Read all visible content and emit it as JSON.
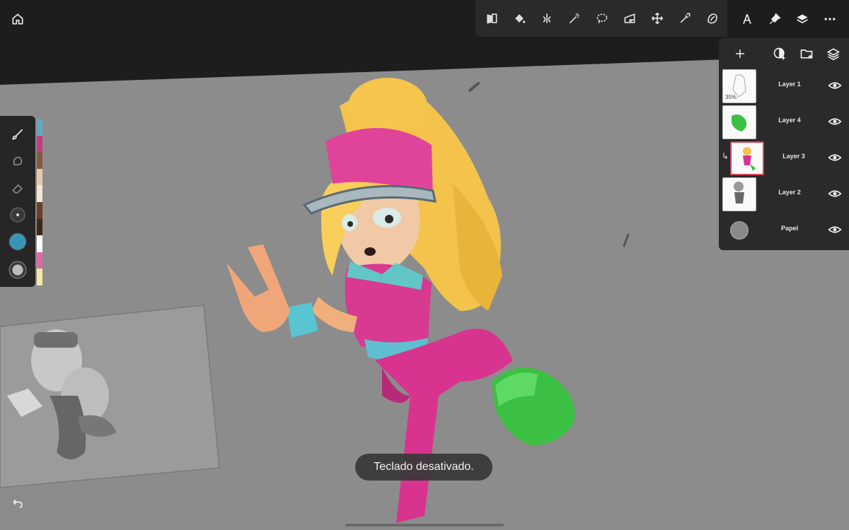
{
  "toolbar": {
    "icons": [
      "image-adjust-icon",
      "fill-icon",
      "symmetry-icon",
      "magic-wand-icon",
      "lasso-icon",
      "perspective-icon",
      "move-icon",
      "eyedropper-icon",
      "liquify-icon"
    ]
  },
  "right_tools": {
    "icons": [
      "ruler-compass-icon",
      "pin-icon",
      "layers-icon",
      "more-icon"
    ]
  },
  "left_palette": {
    "tools": [
      "brush-icon",
      "smudge-icon",
      "eraser-icon",
      "brush-size-icon",
      "current-color-swatch",
      "brush-opacity-icon"
    ],
    "current_color": "#3a95b5",
    "strip_colors": [
      "#5fa9c4",
      "#c83a7f",
      "#8a5a3c",
      "#e5cba8",
      "#f2e6d4",
      "#6e3d24",
      "#3a2818",
      "#ffffff",
      "#e565a4",
      "#f4eaa2"
    ]
  },
  "layers_panel": {
    "add_icon": "plus-icon",
    "new_fill_layer_icon": "new-fill-layer-icon",
    "new_group_icon": "new-folder-icon",
    "blend_icon": "stacked-layers-icon",
    "layers": [
      {
        "name": "Layer 1",
        "opacity": "35%",
        "selected": false,
        "clipped": false
      },
      {
        "name": "Layer 4",
        "opacity": "",
        "selected": false,
        "clipped": false
      },
      {
        "name": "Layer 3",
        "opacity": "",
        "selected": true,
        "clipped": true
      },
      {
        "name": "Layer 2",
        "opacity": "",
        "selected": false,
        "clipped": false
      }
    ],
    "paper": {
      "name": "Papel",
      "color": "#8a8a8a"
    }
  },
  "toast": {
    "text": "Teclado desativado."
  },
  "colors": {
    "canvas": "#8c8c8c",
    "ui_dark": "#1d1d1d",
    "panel": "#2a2a2a",
    "selected_layer": "#d24455"
  }
}
